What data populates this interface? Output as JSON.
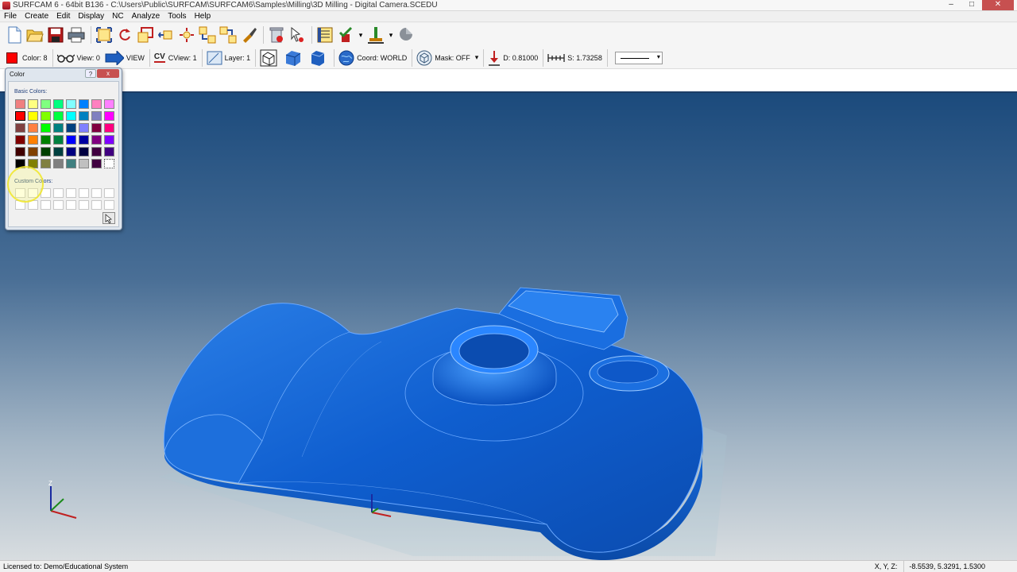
{
  "window": {
    "title": "SURFCAM 6 - 64bit B136 - C:\\Users\\Public\\SURFCAM\\SURFCAM6\\Samples\\Milling\\3D Milling - Digital Camera.SCEDU",
    "min_glyph": "–",
    "max_glyph": "□",
    "close_glyph": "✕"
  },
  "menu": {
    "items": [
      "File",
      "Create",
      "Edit",
      "Display",
      "NC",
      "Analyze",
      "Tools",
      "Help"
    ]
  },
  "toolbar2": {
    "color_label": "Color: 8",
    "view_label": "View: 0",
    "view_mode": "VIEW",
    "cview_icon_text": "CV",
    "cview_label": "CView: 1",
    "layer_label": "Layer: 1",
    "coord_label": "Coord: WORLD",
    "mask_label": "Mask: OFF",
    "depth_label": "D: 0.81000",
    "step_label": "S: 1.73258",
    "dropdown_glyph": "▾",
    "current_color": "#ff0000"
  },
  "dialog": {
    "title": "Color",
    "help_glyph": "?",
    "close_glyph": "x",
    "basic_label": "Basic Colors:",
    "custom_label": "Custom Colors:",
    "basic_colors": [
      "#f08080",
      "#ffff80",
      "#80ff80",
      "#00ff80",
      "#80ffff",
      "#0080ff",
      "#ff80c0",
      "#ff80ff",
      "#ff0000",
      "#ffff00",
      "#80ff00",
      "#00ff40",
      "#00ffff",
      "#0080c0",
      "#8080c0",
      "#ff00ff",
      "#804040",
      "#ff8040",
      "#00ff00",
      "#008080",
      "#004080",
      "#8080ff",
      "#800040",
      "#ff0080",
      "#800000",
      "#ff8000",
      "#008000",
      "#008040",
      "#0000ff",
      "#0000a0",
      "#800080",
      "#8000ff",
      "#400000",
      "#804000",
      "#004000",
      "#004040",
      "#000080",
      "#000040",
      "#400040",
      "#400080",
      "#000000",
      "#808000",
      "#808040",
      "#808080",
      "#408080",
      "#c0c0c0",
      "#400040",
      "#ffffff"
    ],
    "selected_index": 8
  },
  "statusbar": {
    "license": "Licensed to: Demo/Educational System",
    "coord_label": "X, Y, Z:",
    "coord_value": "-8.5539, 5.3291, 1.5300"
  },
  "triad": {
    "z_label": "Z"
  }
}
